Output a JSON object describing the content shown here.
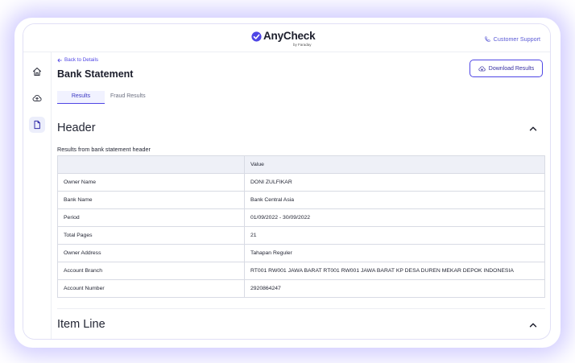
{
  "header": {
    "logo_text": "AnyCheck",
    "logo_sub": "by Faraday",
    "support_label": "Customer Support"
  },
  "sidebar": {
    "items": [
      {
        "icon": "home-icon"
      },
      {
        "icon": "cloud-upload-icon"
      },
      {
        "icon": "document-icon",
        "active": true
      }
    ]
  },
  "page": {
    "back_label": "Back to Details",
    "title": "Bank Statement",
    "download_label": "Download Results",
    "tabs": [
      {
        "label": "Results",
        "active": true
      },
      {
        "label": "Fraud Results",
        "active": false
      }
    ]
  },
  "sections": {
    "header": {
      "title": "Header",
      "description": "Results from bank statement header",
      "columns": [
        "",
        "Value"
      ],
      "rows": [
        {
          "field": "Owner Name",
          "value": "DONI ZULFIKAR"
        },
        {
          "field": "Bank Name",
          "value": "Bank Central Asia"
        },
        {
          "field": "Period",
          "value": "01/09/2022 - 30/09/2022"
        },
        {
          "field": "Total Pages",
          "value": "21"
        },
        {
          "field": "Owner Address",
          "value": "Tahapan Reguler"
        },
        {
          "field": "Account Branch",
          "value": "RT001 RW001 JAWA BARAT RT001 RW001 JAWA BARAT KP DESA DUREN MEKAR DEPOK INDONESIA"
        },
        {
          "field": "Account Number",
          "value": "2920864247"
        }
      ]
    },
    "item_line": {
      "title": "Item Line"
    }
  },
  "colors": {
    "accent": "#4f46e5",
    "glow": "#968cff"
  }
}
